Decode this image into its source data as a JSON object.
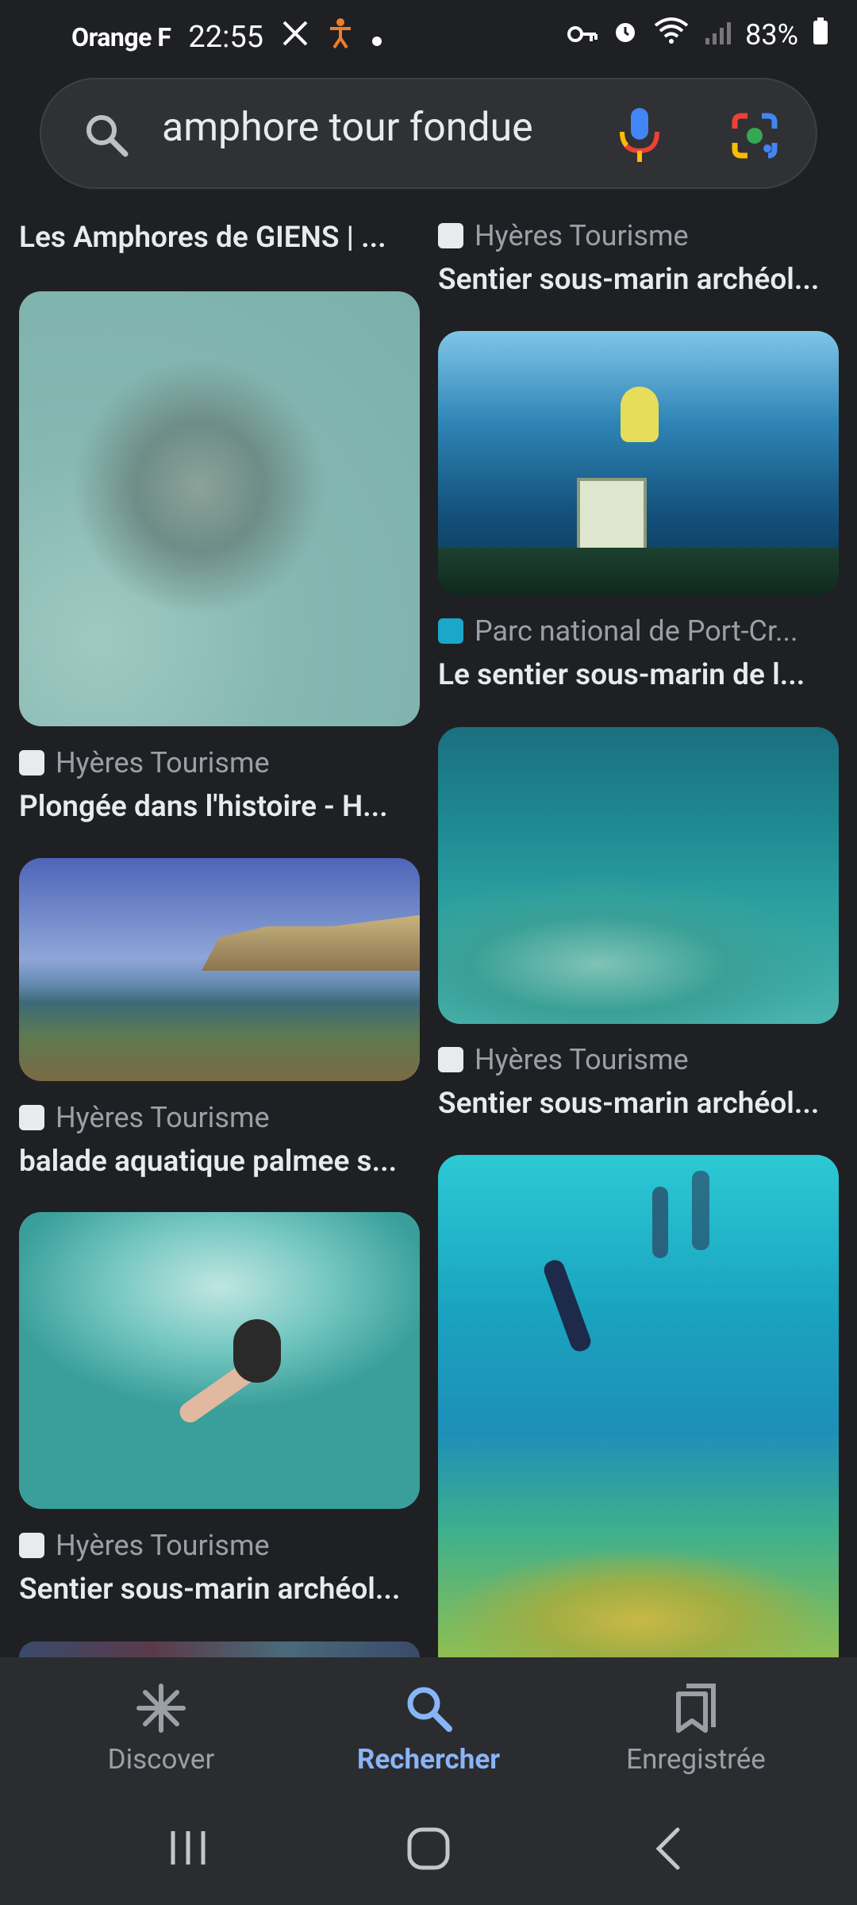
{
  "status_bar": {
    "carrier": "Orange F",
    "time": "22:55",
    "battery": "83%"
  },
  "search": {
    "query": "amphore tour fondue"
  },
  "results": {
    "left": [
      {
        "source": "",
        "title": "Les Amphores de GIENS | ..."
      },
      {
        "source": "Hyères Tourisme",
        "title": "Plongée dans l'histoire - H..."
      },
      {
        "source": "Hyères Tourisme",
        "title": "balade aquatique palmee s..."
      },
      {
        "source": "Hyères Tourisme",
        "title": "Sentier sous-marin archéol..."
      }
    ],
    "right": [
      {
        "source": "Hyères Tourisme",
        "title": "Sentier sous-marin archéol..."
      },
      {
        "source": "Parc national de Port-Cr...",
        "title": "Le sentier sous-marin de l..."
      },
      {
        "source": "Hyères Tourisme",
        "title": "Sentier sous-marin archéol..."
      }
    ]
  },
  "bottom_nav": {
    "items": [
      {
        "label": "Discover",
        "icon": "asterisk-icon",
        "active": false
      },
      {
        "label": "Rechercher",
        "icon": "search-icon",
        "active": true
      },
      {
        "label": "Enregistrée",
        "icon": "bookmarks-icon",
        "active": false
      }
    ]
  },
  "colors": {
    "background": "#1f2023",
    "accent": "#8ab4f8",
    "muted": "#9aa0a6"
  }
}
